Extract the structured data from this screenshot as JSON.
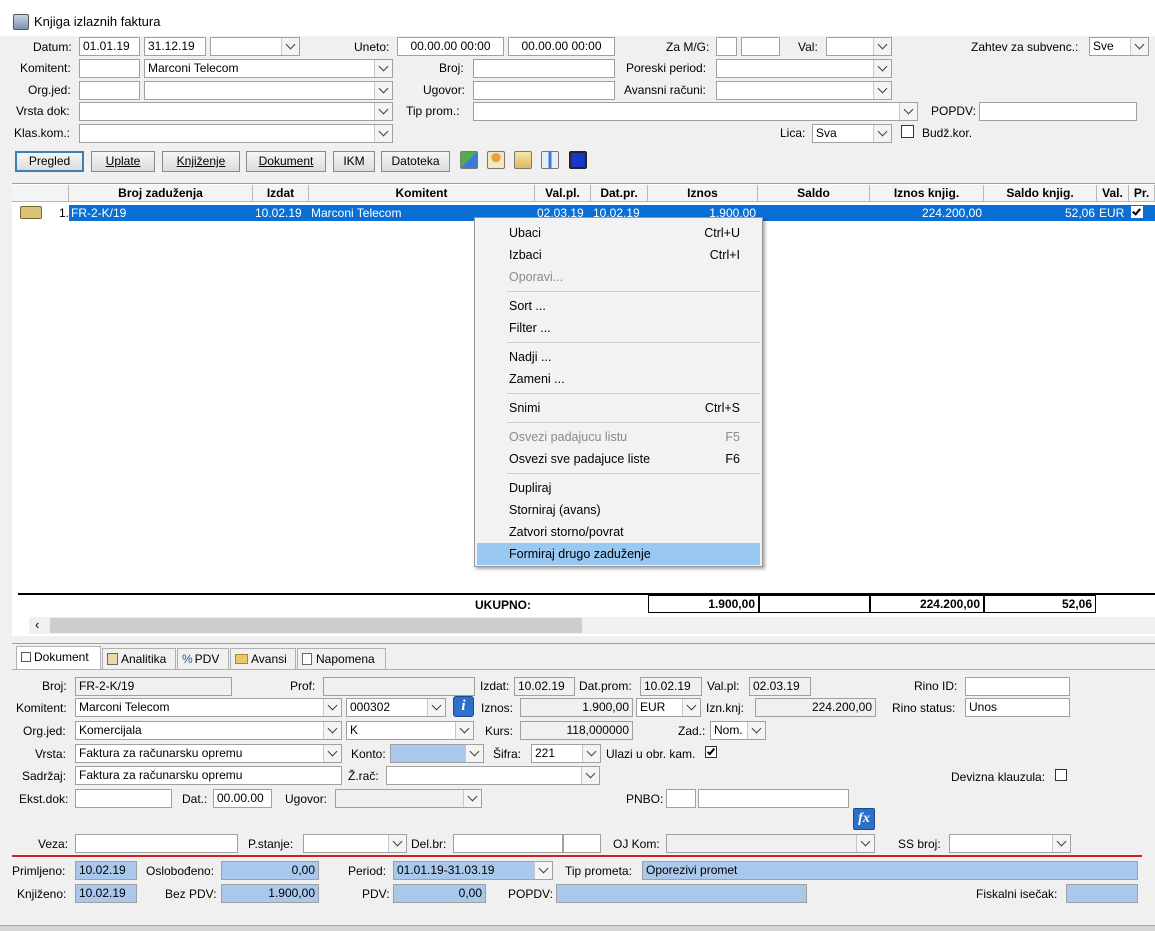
{
  "window": {
    "title": "Knjiga izlaznih faktura"
  },
  "filters": {
    "datum_label": "Datum:",
    "datum_from": "01.01.19",
    "datum_to": "31.12.19",
    "uneto_label": "Uneto:",
    "uneto_from": "00.00.00 00:00",
    "uneto_to": "00.00.00 00:00",
    "za_mg_label": "Za M/G:",
    "val_label": "Val:",
    "zahtev_label": "Zahtev za subvenc.:",
    "zahtev_value": "Sve",
    "komitent_label": "Komitent:",
    "komitent_value": "Marconi Telecom",
    "broj_label": "Broj:",
    "poreski_label": "Poreski period:",
    "orgjed_label": "Org.jed:",
    "ugovor_label": "Ugovor:",
    "avansni_label": "Avansni računi:",
    "vrsta_label": "Vrsta dok:",
    "tipprom_label": "Tip prom.:",
    "popdv_label": "POPDV:",
    "klaskom_label": "Klas.kom.:",
    "lica_label": "Lica:",
    "lica_value": "Sva",
    "budz_label": "Budž.kor."
  },
  "toolbar": {
    "pregled": "Pregled",
    "uplate": "Uplate",
    "knjizenje": "Knjiženje",
    "dokument": "Dokument",
    "ikm": "IKM",
    "datoteka": "Datoteka"
  },
  "grid": {
    "columns": [
      "Broj zaduženja",
      "Izdat",
      "Komitent",
      "Val.pl.",
      "Dat.pr.",
      "Iznos",
      "Saldo",
      "Iznos knjig.",
      "Saldo knjig.",
      "Val.",
      "Pr."
    ],
    "rows": [
      {
        "num": "1.",
        "broj": "FR-2-K/19",
        "izdat": "10.02.19",
        "komitent": "Marconi Telecom",
        "valpl": "02.03.19",
        "datpr": "10.02.19",
        "iznos": "1.900,00",
        "saldo": "",
        "iznos_knjig": "224.200,00",
        "saldo_knjig": "52,06",
        "val": "EUR",
        "pr": true
      }
    ],
    "total_label": "UKUPNO:",
    "total_iznos": "1.900,00",
    "total_iznos_knjig": "224.200,00",
    "total_saldo_knjig": "52,06"
  },
  "context_menu": {
    "ubaci": "Ubaci",
    "ubaci_sc": "Ctrl+U",
    "izbaci": "Izbaci",
    "izbaci_sc": "Ctrl+I",
    "oporavi": "Oporavi...",
    "sort": "Sort ...",
    "filter": "Filter ...",
    "nadji": "Nadji ...",
    "zameni": "Zameni ...",
    "snimi": "Snimi",
    "snimi_sc": "Ctrl+S",
    "osvezi": "Osvezi padajucu listu",
    "osvezi_sc": "F5",
    "osvezi_sve": "Osvezi sve padajuce liste",
    "osvezi_sve_sc": "F6",
    "dupliraj": "Dupliraj",
    "storniraj": "Storniraj (avans)",
    "zatvori": "Zatvori storno/povrat",
    "formiraj": "Formiraj drugo zaduženje"
  },
  "tabs": [
    "Dokument",
    "Analitika",
    "PDV",
    "Avansi",
    "Napomena"
  ],
  "detail": {
    "broj_label": "Broj:",
    "broj": "FR-2-K/19",
    "prof_label": "Prof:",
    "izdat_label": "Izdat:",
    "izdat": "10.02.19",
    "datprom_label": "Dat.prom:",
    "datprom": "10.02.19",
    "valpl_label": "Val.pl:",
    "valpl": "02.03.19",
    "rino_id_label": "Rino ID:",
    "komitent_label": "Komitent:",
    "komitent": "Marconi Telecom",
    "komitent_code": "000302",
    "iznos_label": "Iznos:",
    "iznos": "1.900,00",
    "iznos_val": "EUR",
    "iznknj_label": "Izn.knj:",
    "iznknj": "224.200,00",
    "rino_status_label": "Rino status:",
    "rino_status": "Unos",
    "orgjed_label": "Org.jed:",
    "orgjed": "Komercijala",
    "orgjed_code": "K",
    "kurs_label": "Kurs:",
    "kurs": "118,000000",
    "zad_label": "Zad.:",
    "zad": "Nom.",
    "vrsta_label": "Vrsta:",
    "vrsta": "Faktura za računarsku opremu",
    "konto_label": "Konto:",
    "sifra_label": "Šifra:",
    "sifra": "221",
    "ulazi_label": "Ulazi u obr. kam.",
    "sadrzaj_label": "Sadržaj:",
    "sadrzaj": "Faktura za računarsku opremu",
    "zrac_label": "Ž.rač:",
    "devizna_label": "Devizna klauzula:",
    "ekst_label": "Ekst.dok:",
    "dat_label": "Dat.:",
    "dat": "00.00.00",
    "ugovor_label": "Ugovor:",
    "pnbo_label": "PNBO:",
    "veza_label": "Veza:",
    "pstanje_label": "P.stanje:",
    "delbr_label": "Del.br:",
    "ojkom_label": "OJ Kom:",
    "ssbroj_label": "SS broj:"
  },
  "footer": {
    "primljeno_label": "Primljeno:",
    "primljeno": "10.02.19",
    "oslobodjeno_label": "Oslobođeno:",
    "oslobodjeno": "0,00",
    "period_label": "Period:",
    "period": "01.01.19-31.03.19",
    "tipprometa_label": "Tip prometa:",
    "tipprometa": "Oporezivi promet",
    "knjizeno_label": "Knjiženo:",
    "knjizeno": "10.02.19",
    "bezpdv_label": "Bez PDV:",
    "bezpdv": "1.900,00",
    "pdv_label": "PDV:",
    "pdv": "0,00",
    "popdv_label": "POPDV:",
    "fiskalni_label": "Fiskalni isečak:"
  },
  "colors": {
    "selection": "#0a6fd4",
    "menu_highlight": "#99c9f2",
    "blue_field": "#a9c8ec",
    "red_line": "#d22020"
  }
}
